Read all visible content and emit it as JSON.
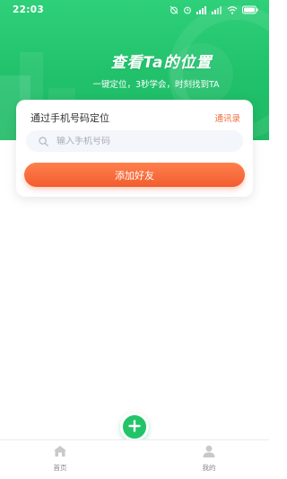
{
  "status_bar": {
    "time": "22:03",
    "icons": [
      "alarm-off-icon",
      "alarm-icon",
      "signal-hd-icon",
      "signal-icon",
      "wifi-icon",
      "battery-icon"
    ]
  },
  "hero": {
    "title": "查看Ta的位置",
    "subtitle": "一键定位，3秒学会，时刻找到TA"
  },
  "card": {
    "title": "通过手机号码定位",
    "contacts_link": "通讯录",
    "phone_placeholder": "输入手机号码",
    "phone_value": "",
    "add_button": "添加好友"
  },
  "tabbar": {
    "home_label": "首页",
    "mine_label": "我的",
    "center_action_icon": "plus-icon"
  },
  "colors": {
    "brand_green": "#22c46a",
    "accent_orange": "#f25d2f",
    "link_orange": "#f06c3e"
  }
}
